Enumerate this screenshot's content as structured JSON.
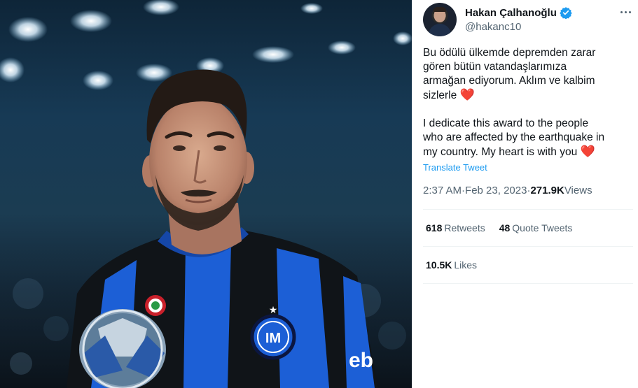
{
  "media": {
    "image_alt_icon": "player-photo",
    "sponsor_text": "eb"
  },
  "tweet": {
    "author": {
      "display_name": "Hakan Çalhanoğlu",
      "handle": "@hakanc10",
      "verified": true,
      "avatar_icon": "avatar"
    },
    "text_tr_lines": "Bu ödülü ülkemde depremden zarar\ngören bütün vatandaşlarımıza\narmağan ediyorum. Aklım ve kalbim\nsizlerle",
    "text_en_lines": "I dedicate this award to the people\nwho are affected by the earthquake in\nmy country. My heart is with you",
    "heart_emoji": "❤️",
    "translate_label": "Translate Tweet",
    "time": "2:37 AM",
    "date": "Feb 23, 2023",
    "separator": " · ",
    "views_count": "271.9K",
    "views_label": " Views",
    "retweets_count": "618",
    "retweets_label": "Retweets",
    "quote_count": "48",
    "quote_label": "Quote Tweets",
    "likes_count": "10.5K",
    "likes_label": "Likes"
  },
  "colors": {
    "accent": "#1d9bf0",
    "secondary_text": "#536471",
    "primary_text": "#0f1419",
    "heart": "#e0245e",
    "jersey_blue": "#1c5fd6",
    "jersey_black": "#101418"
  }
}
